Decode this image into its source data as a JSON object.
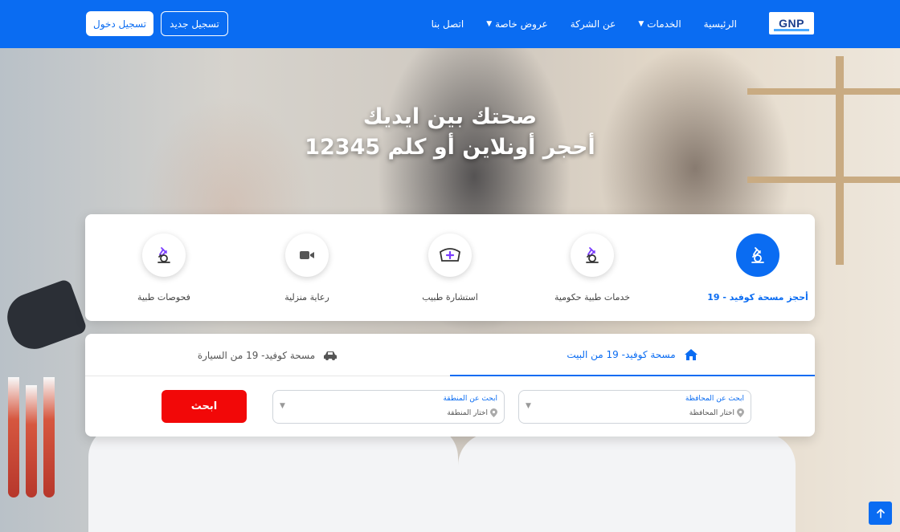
{
  "colors": {
    "primary": "#0a6cf2",
    "danger": "#f20808"
  },
  "navbar": {
    "logo": "GNP",
    "links": [
      {
        "label": "الرئيسية"
      },
      {
        "label": "الخدمات",
        "dropdown": true
      },
      {
        "label": "عن الشركة"
      },
      {
        "label": "عروض خاصة",
        "dropdown": true
      },
      {
        "label": "اتصل بنا"
      }
    ],
    "register_label": "تسجيل جديد",
    "login_label": "تسجيل دخول",
    "caret": "▼"
  },
  "hero": {
    "line1": "صحتك بين ايديك",
    "line2": "أحجر أونلاين أو كلم 12345"
  },
  "services": [
    {
      "label": "أحجز مسحة كوفيد - 19",
      "icon": "microscope-icon",
      "active": true
    },
    {
      "label": "خدمات طبية حكومية",
      "icon": "microscope-icon",
      "active": false
    },
    {
      "label": "استشارة طبيب",
      "icon": "nurse-cap-icon",
      "active": false
    },
    {
      "label": "رعاية منزلية",
      "icon": "video-camera-icon",
      "active": false
    },
    {
      "label": "فحوصات طبية",
      "icon": "microscope-icon",
      "active": false
    }
  ],
  "booking": {
    "tab_home": "مسحة كوفيد- 19 من البيت",
    "tab_car": "مسحة كوفيد- 19 من السيارة",
    "governorate": {
      "label": "ابحث عن المحافظة",
      "value": "اختار المحافظة"
    },
    "area": {
      "label": "ابحث عن المنطقة",
      "value": "اختار المنطقة"
    },
    "search_label": "ابحث"
  }
}
